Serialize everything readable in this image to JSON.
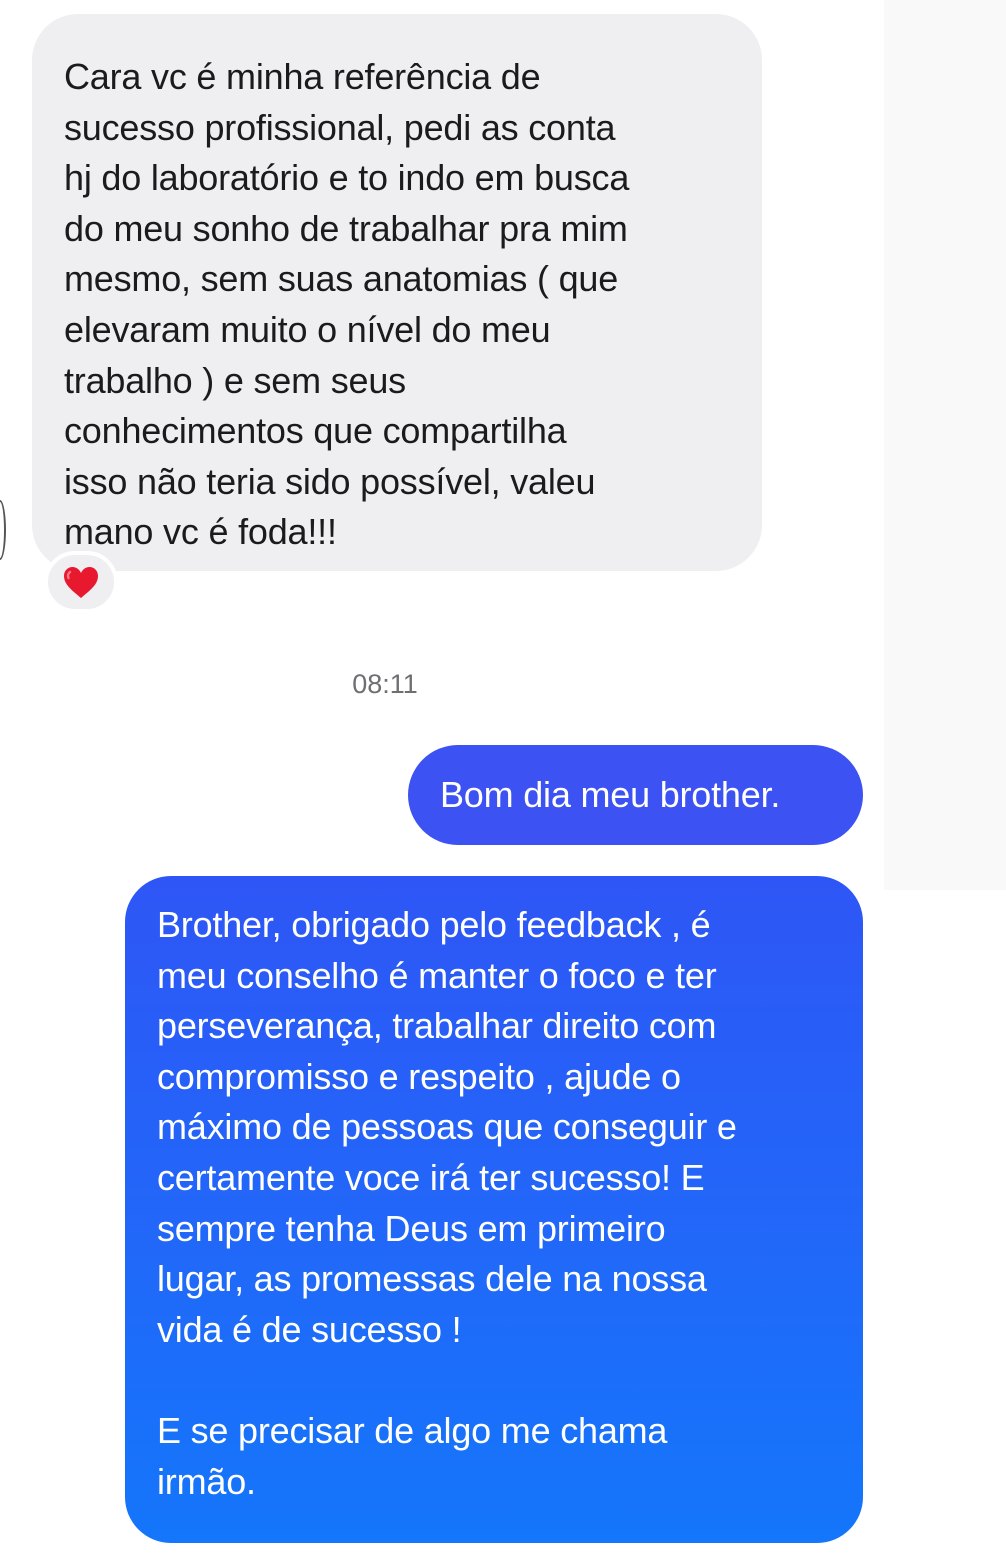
{
  "conversation": {
    "incoming_message": {
      "text": "Cara vc é minha referência de\nsucesso profissional, pedi as conta\nhj do laboratório e to indo em busca\ndo meu sonho de trabalhar pra mim\nmesmo, sem suas anatomias ( que\nelevaram muito o nível do meu\ntrabalho ) e sem seus\nconhecimentos que compartilha\nisso não teria sido possível, valeu\nmano vc é foda!!!",
      "reaction_icon": "red-heart-icon",
      "bubble_color": "#efeff1"
    },
    "timestamp": "08:11",
    "outgoing_messages": [
      {
        "text": "Bom dia meu brother.",
        "bubble_color": "#3d52f2"
      },
      {
        "text": "Brother, obrigado pelo feedback , é\nmeu conselho é manter o foco e ter\nperseverança, trabalhar direito com\ncompromisso e respeito , ajude o\nmáximo de pessoas que conseguir e\ncertamente voce irá ter sucesso! E\nsempre tenha Deus em primeiro\nlugar, as promessas dele na nossa\nvida é de sucesso !\n\nE se precisar de algo me chama\nirmão.",
        "bubble_color_top": "#2e56f6",
        "bubble_color_bottom": "#1476fa"
      }
    ]
  }
}
